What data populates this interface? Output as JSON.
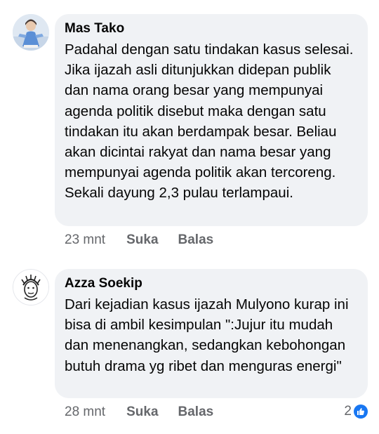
{
  "comments": [
    {
      "author": "Mas Tako",
      "text": "Padahal dengan satu tindakan kasus selesai. Jika ijazah asli ditunjukkan didepan publik dan nama orang besar yang mempunyai agenda politik disebut maka dengan satu tindakan itu akan berdampak besar. Beliau akan dicintai rakyat dan nama besar yang mempunyai agenda politik akan tercoreng. Sekali dayung 2,3 pulau terlampaui.",
      "time": "23 mnt",
      "like_label": "Suka",
      "reply_label": "Balas"
    },
    {
      "author": "Azza Soekip",
      "text": "Dari kejadian kasus ijazah Mulyono kurap ini bisa di ambil kesimpulan \":Jujur itu mudah dan menenangkan, sedangkan kebohongan butuh drama yg ribet dan menguras energi\"",
      "time": "28 mnt",
      "like_label": "Suka",
      "reply_label": "Balas",
      "reaction_count": "2",
      "reaction_icon": "thumbs-up-icon"
    }
  ],
  "colors": {
    "bubble": "#f0f2f5",
    "meta_text": "#65676b",
    "like_blue": "#1877f2"
  }
}
